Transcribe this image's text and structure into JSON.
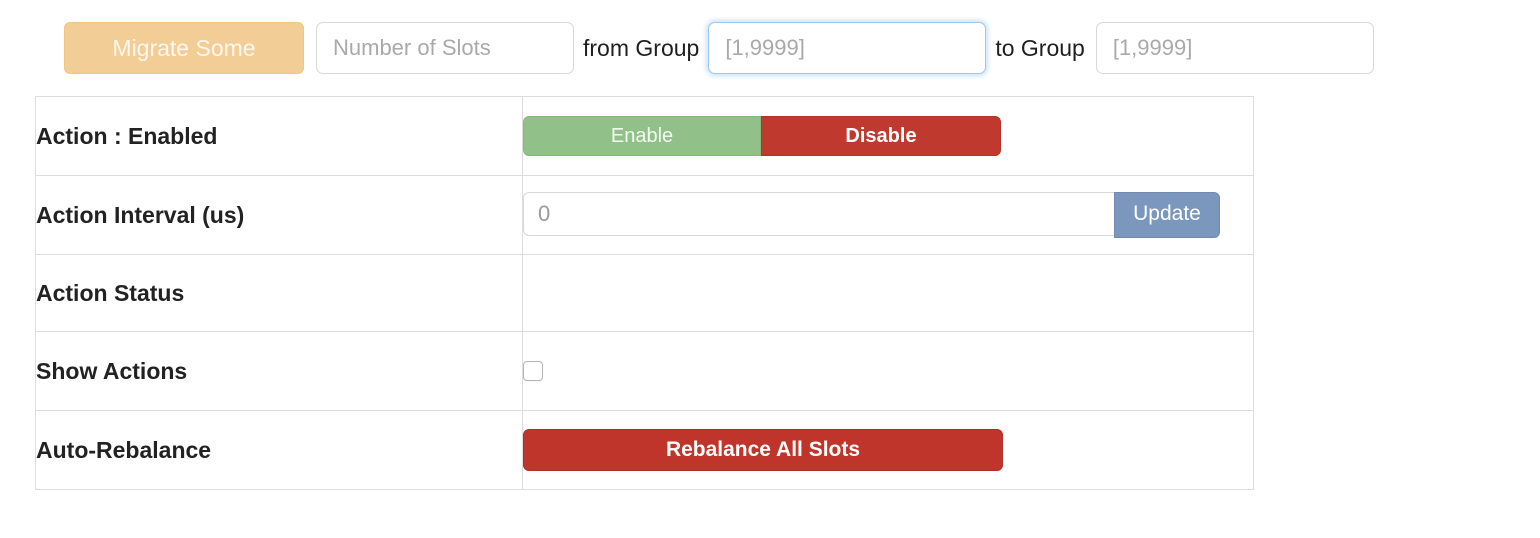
{
  "migrate_bar": {
    "migrate_button_label": "Migrate Some",
    "slots_input_value": "",
    "slots_input_placeholder": "Number of Slots",
    "from_group_label": "from Group",
    "from_group_value": "",
    "from_group_placeholder": "[1,9999]",
    "to_group_label": "to Group",
    "to_group_value": "",
    "to_group_placeholder": "[1,9999]"
  },
  "settings": {
    "rows": [
      {
        "label": "Action : Enabled",
        "enable_label": "Enable",
        "disable_label": "Disable"
      },
      {
        "label": "Action Interval (us)",
        "interval_value": "",
        "interval_placeholder": "0",
        "update_label": "Update"
      },
      {
        "label": "Action Status",
        "status_value": ""
      },
      {
        "label": "Show Actions",
        "checked": false
      },
      {
        "label": "Auto-Rebalance",
        "rebalance_label": "Rebalance All Slots"
      }
    ]
  },
  "colors": {
    "migrate_button_bg": "#f3cd96",
    "enable_bg": "#91c189",
    "disable_bg": "#c0392f",
    "update_bg": "#7c97bd",
    "rebalance_bg": "#bf352b",
    "focus_border": "#9fc8e8",
    "table_border": "#dddddd",
    "label_text": "#222222"
  }
}
